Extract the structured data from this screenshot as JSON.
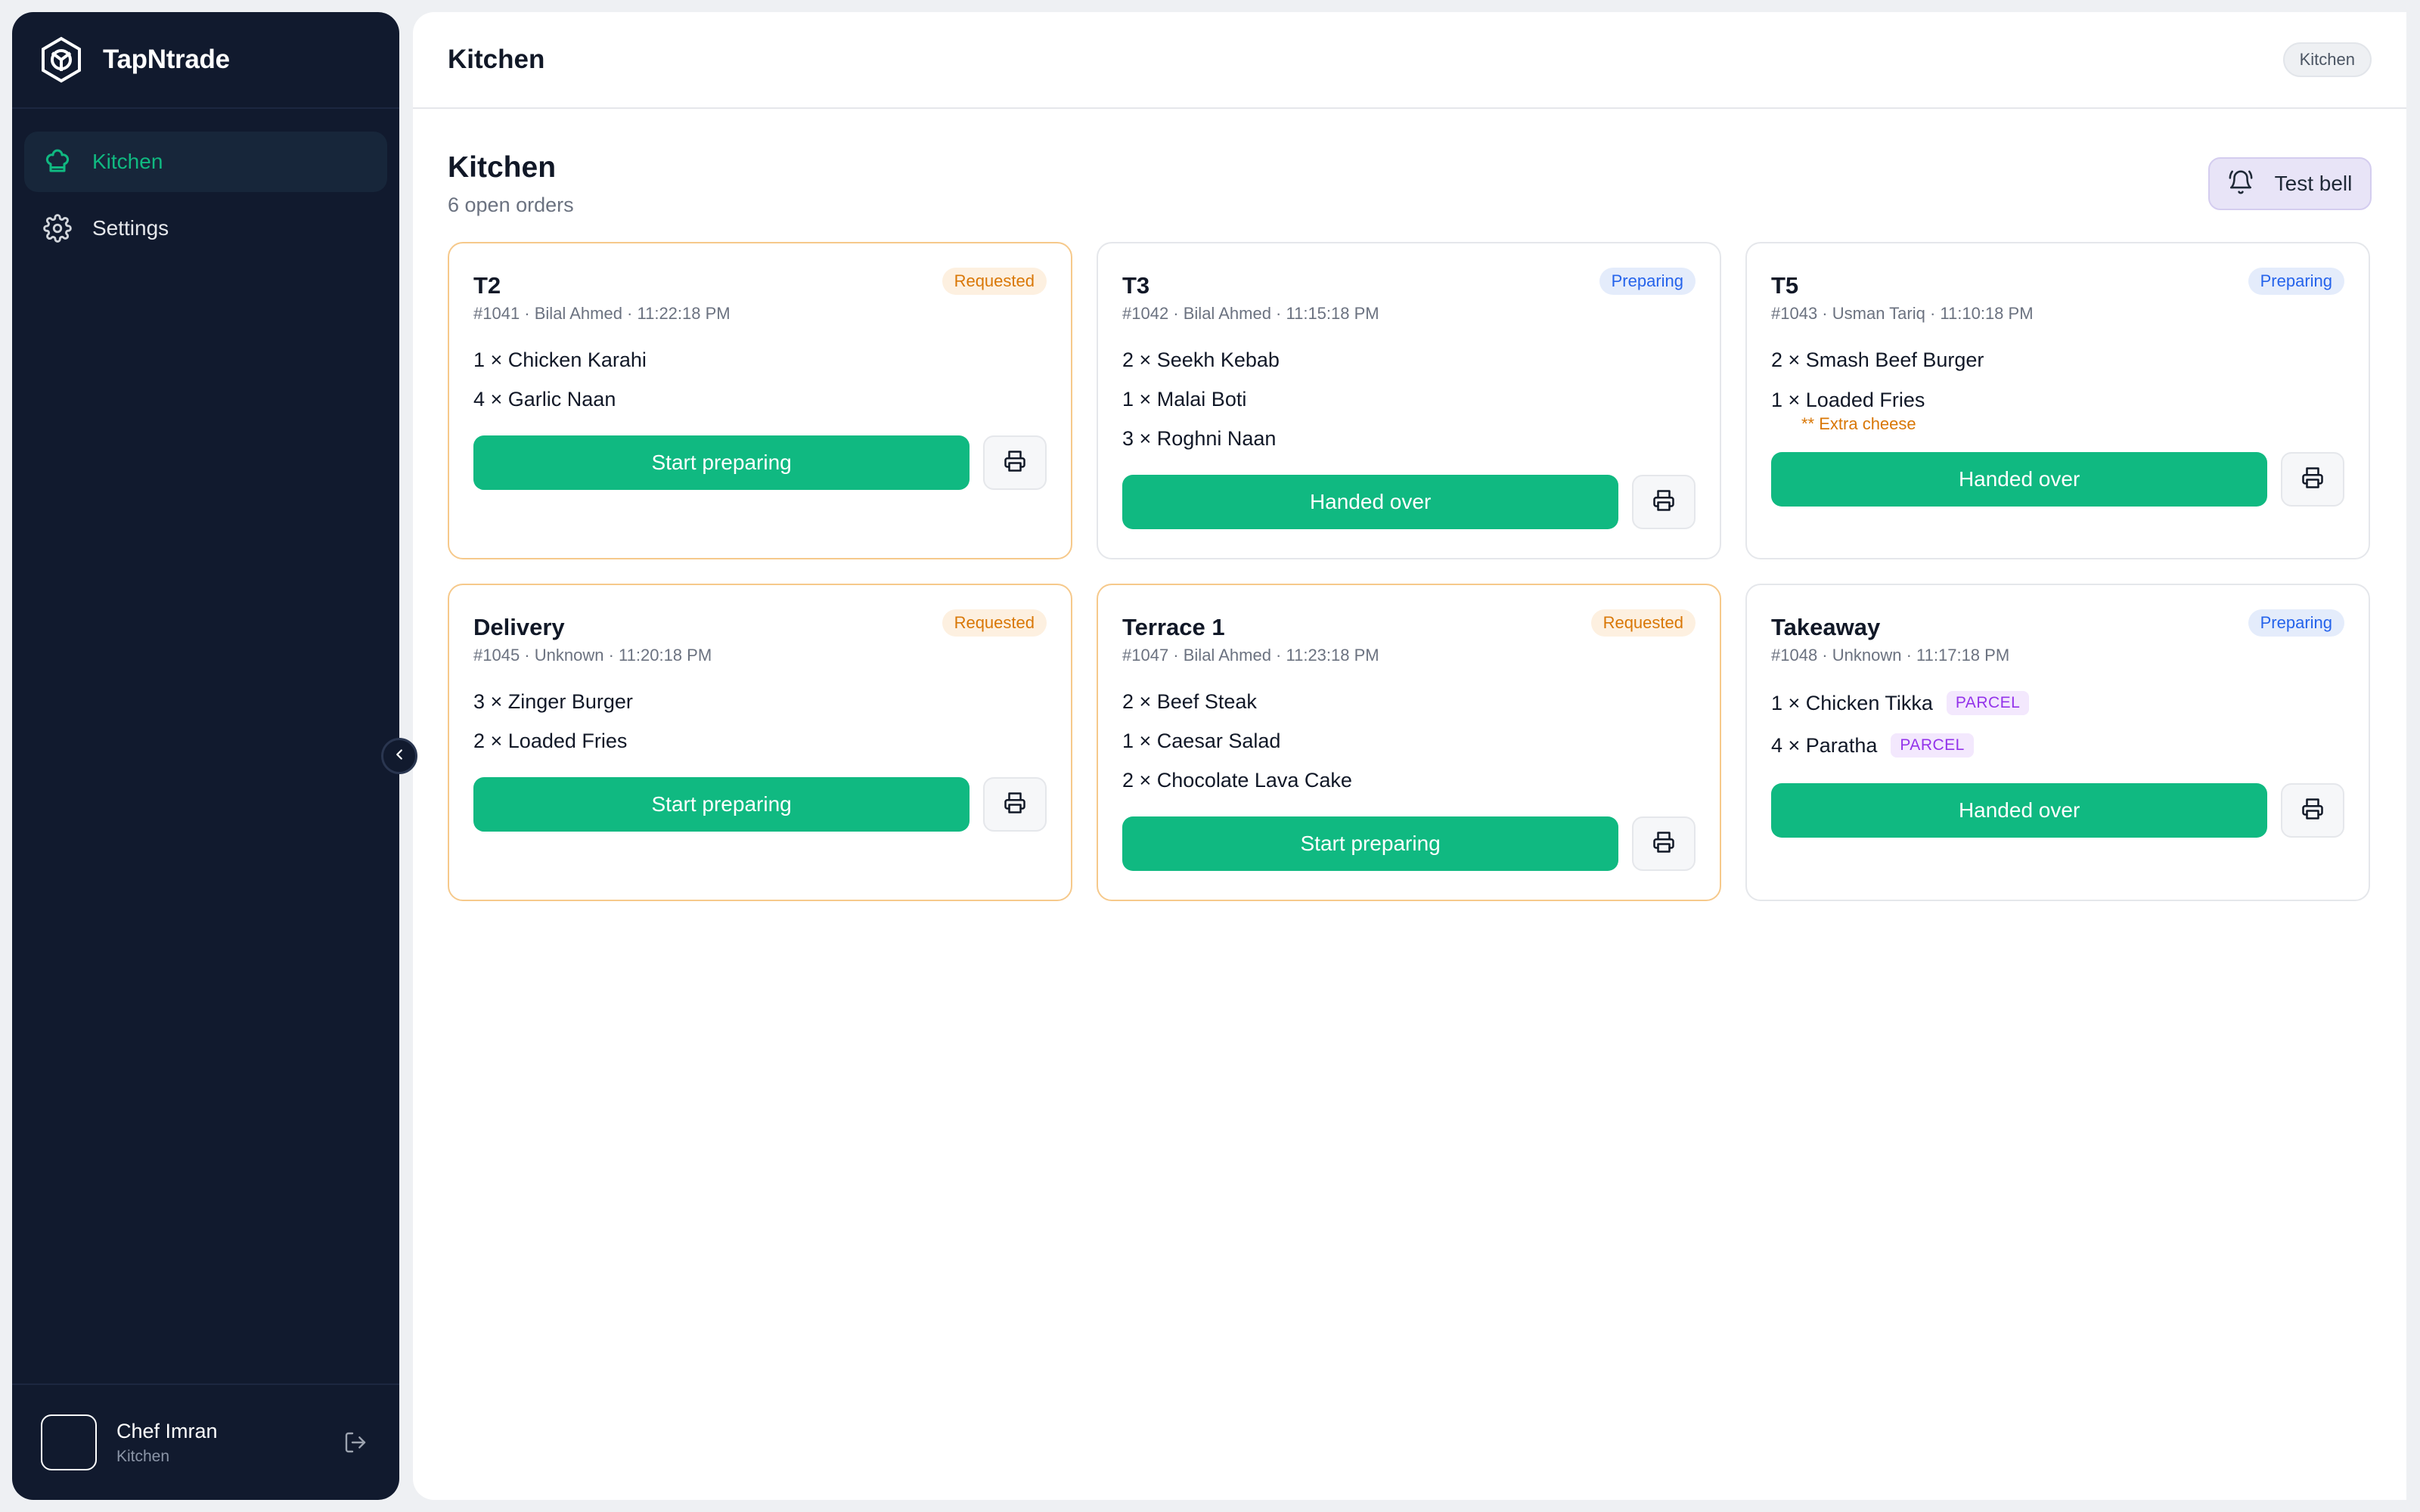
{
  "app": {
    "brand": "TapNtrade"
  },
  "sidebar": {
    "items": [
      {
        "label": "Kitchen",
        "icon": "chef-hat-icon",
        "active": true
      },
      {
        "label": "Settings",
        "icon": "gear-icon",
        "active": false
      }
    ],
    "user": {
      "name": "Chef Imran",
      "role": "Kitchen"
    }
  },
  "topbar": {
    "title": "Kitchen",
    "badge": "Kitchen"
  },
  "page": {
    "title": "Kitchen",
    "subtitle": "6 open orders",
    "test_bell_label": "Test bell"
  },
  "colors": {
    "accent": "#10b981",
    "sidebar_bg": "#111a2e",
    "requested": "#d97706",
    "preparing": "#2563eb",
    "parcel": "#9333ea"
  },
  "orders": [
    {
      "table": "T2",
      "status": "Requested",
      "number": "#1041",
      "customer": "Bilal Ahmed",
      "time": "11:22:18 PM",
      "items": [
        {
          "text": "1 × Chicken Karahi"
        },
        {
          "text": "4 × Garlic Naan"
        }
      ],
      "action": "Start preparing"
    },
    {
      "table": "T3",
      "status": "Preparing",
      "number": "#1042",
      "customer": "Bilal Ahmed",
      "time": "11:15:18 PM",
      "items": [
        {
          "text": "2 × Seekh Kebab"
        },
        {
          "text": "1 × Malai Boti"
        },
        {
          "text": "3 × Roghni Naan"
        }
      ],
      "action": "Handed over"
    },
    {
      "table": "T5",
      "status": "Preparing",
      "number": "#1043",
      "customer": "Usman Tariq",
      "time": "11:10:18 PM",
      "items": [
        {
          "text": "2 × Smash Beef Burger"
        },
        {
          "text": "1 × Loaded Fries",
          "note": "** Extra cheese"
        }
      ],
      "action": "Handed over"
    },
    {
      "table": "Delivery",
      "status": "Requested",
      "number": "#1045",
      "customer": "Unknown",
      "time": "11:20:18 PM",
      "items": [
        {
          "text": "3 × Zinger Burger"
        },
        {
          "text": "2 × Loaded Fries"
        }
      ],
      "action": "Start preparing"
    },
    {
      "table": "Terrace 1",
      "status": "Requested",
      "number": "#1047",
      "customer": "Bilal Ahmed",
      "time": "11:23:18 PM",
      "items": [
        {
          "text": "2 × Beef Steak"
        },
        {
          "text": "1 × Caesar Salad"
        },
        {
          "text": "2 × Chocolate Lava Cake"
        }
      ],
      "action": "Start preparing"
    },
    {
      "table": "Takeaway",
      "status": "Preparing",
      "number": "#1048",
      "customer": "Unknown",
      "time": "11:17:18 PM",
      "items": [
        {
          "text": "1 × Chicken Tikka",
          "tag": "PARCEL"
        },
        {
          "text": "4 × Paratha",
          "tag": "PARCEL"
        }
      ],
      "action": "Handed over"
    }
  ]
}
